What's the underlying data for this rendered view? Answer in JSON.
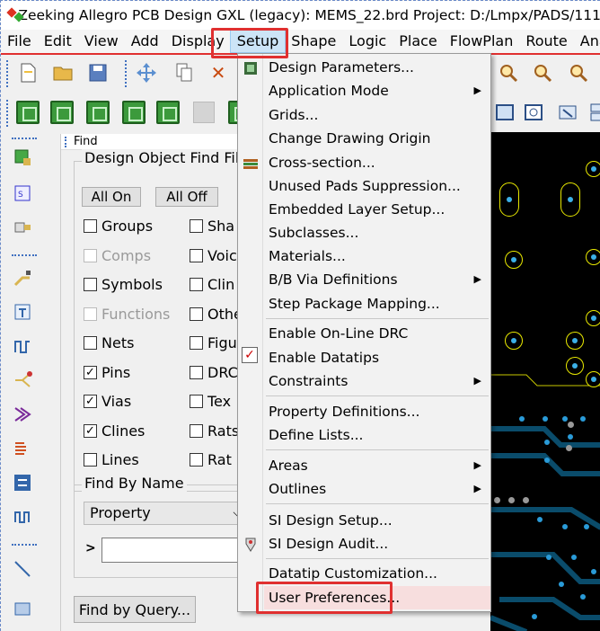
{
  "title": "Zeeking Allegro PCB Design GXL (legacy): MEMS_22.brd  Project: D:/Lmpx/PADS/111",
  "menubar": [
    "File",
    "Edit",
    "View",
    "Add",
    "Display",
    "Setup",
    "Shape",
    "Logic",
    "Place",
    "FlowPlan",
    "Route",
    "Ana"
  ],
  "find_panel": {
    "header": "Find",
    "group_label": "Design Object Find Filt",
    "all_on": "All On",
    "all_off": "All Off",
    "left_items": [
      {
        "label": "Groups",
        "checked": false,
        "disabled": false
      },
      {
        "label": "Comps",
        "checked": false,
        "disabled": true
      },
      {
        "label": "Symbols",
        "checked": false,
        "disabled": false
      },
      {
        "label": "Functions",
        "checked": false,
        "disabled": true
      },
      {
        "label": "Nets",
        "checked": false,
        "disabled": false
      },
      {
        "label": "Pins",
        "checked": true,
        "disabled": false
      },
      {
        "label": "Vias",
        "checked": true,
        "disabled": false
      },
      {
        "label": "Clines",
        "checked": true,
        "disabled": false
      },
      {
        "label": "Lines",
        "checked": false,
        "disabled": false
      }
    ],
    "right_items": [
      "Sha",
      "Voic",
      "Clin",
      "Othe",
      "Figu",
      "DRC",
      "Tex",
      "Rats",
      "Rat"
    ],
    "find_by_name_label": "Find By Name",
    "property_select": "Property",
    "prompt_symbol": ">",
    "find_by_query": "Find by Query..."
  },
  "setup_menu": {
    "items": [
      {
        "label": "Design Parameters...",
        "submenu": false,
        "icon": "design-parameters-icon"
      },
      {
        "label": "Application Mode",
        "submenu": true
      },
      {
        "label": "Grids...",
        "submenu": false
      },
      {
        "label": "Change Drawing Origin",
        "submenu": false
      },
      {
        "label": "Cross-section...",
        "submenu": false,
        "icon": "cross-section-icon"
      },
      {
        "label": "Unused Pads Suppression...",
        "submenu": false
      },
      {
        "label": "Embedded Layer Setup...",
        "submenu": false
      },
      {
        "label": "Subclasses...",
        "submenu": false
      },
      {
        "label": "Materials...",
        "submenu": false
      },
      {
        "label": "B/B Via Definitions",
        "submenu": true
      },
      {
        "label": "Step Package Mapping...",
        "submenu": false
      },
      {
        "label": "Enable On-Line DRC",
        "submenu": false
      },
      {
        "label": "Enable Datatips",
        "submenu": false,
        "checked": true
      },
      {
        "label": "Constraints",
        "submenu": true
      },
      {
        "label": "Property Definitions...",
        "submenu": false
      },
      {
        "label": "Define Lists...",
        "submenu": false
      },
      {
        "label": "Areas",
        "submenu": true
      },
      {
        "label": "Outlines",
        "submenu": true
      },
      {
        "label": "SI Design Setup...",
        "submenu": false
      },
      {
        "label": "SI Design Audit...",
        "submenu": false,
        "icon": "si-audit-icon"
      },
      {
        "label": "Datatip Customization...",
        "submenu": false
      },
      {
        "label": "User Preferences...",
        "submenu": false,
        "highlighted": true
      }
    ]
  },
  "colors": {
    "highlight_box": "#e03030",
    "canvas": "#000000",
    "pad_outline": "#e8e800",
    "via": "#2a9bd8"
  }
}
